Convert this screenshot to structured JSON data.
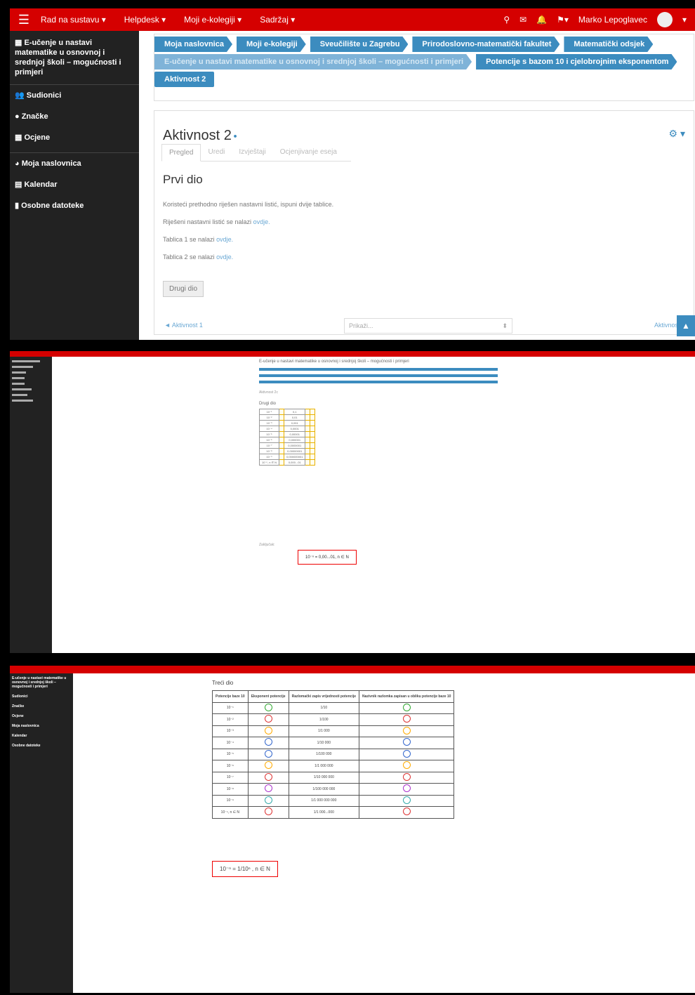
{
  "panel1": {
    "nav": {
      "menu": [
        "Rad na sustavu ▾",
        "Helpdesk ▾",
        "Moji e-kolegiji ▾",
        "Sadržaj ▾"
      ],
      "user": "Marko Lepoglavec"
    },
    "sidebar": {
      "course": "E-učenje u nastavi matematike u osnovnoj i srednjoj školi – mogućnosti i primjeri",
      "items": [
        "Sudionici",
        "Značke",
        "Ocjene"
      ],
      "items2": [
        "Moja naslovnica",
        "Kalendar",
        "Osobne datoteke"
      ]
    },
    "breadcrumbs": {
      "row1": [
        "Moja naslovnica",
        "Moji e-kolegiji",
        "Sveučilište u Zagrebu",
        "Prirodoslovno-matematički fakultet",
        "Matematički odsjek"
      ],
      "row2": [
        "E-učenje u nastavi matematike u osnovnoj i srednjoj školi – mogućnosti i primjeri",
        "Potencije s bazom 10 i cjelobrojnim eksponentom"
      ],
      "row3": [
        "Aktivnost 2"
      ]
    },
    "title": "Aktivnost 2",
    "tabs": [
      "Pregled",
      "Uredi",
      "Izvještaji",
      "Ocjenjivanje eseja"
    ],
    "section": "Prvi dio",
    "para1": "Koristeći prethodno riješen nastavni listić, ispuni dvije tablice.",
    "para2": "Riješeni nastavni listić se nalazi",
    "para3": "Tablica 1 se nalazi",
    "para4": "Tablica 2 se nalazi",
    "link": "ovdje.",
    "button": "Drugi dio",
    "prev": "◄ Aktivnost 1",
    "jump": "Prikaži...",
    "next": "Aktivnost 3"
  },
  "panel2": {
    "header": "E-učenje u nastavi matematike u osnovnoj i srednjoj školi – mogućnosti i primjeri",
    "title": "Aktivnost 2c",
    "section": "Drugi dio",
    "rows": [
      "10⁻¹",
      "10⁻²",
      "10⁻³",
      "10⁻⁴",
      "10⁻⁵",
      "10⁻⁶",
      "10⁻⁷",
      "10⁻⁸",
      "10⁻⁹",
      "10⁻ⁿ, n ∈ N"
    ],
    "values": [
      "0,1",
      "0,01",
      "0,001",
      "0,0001",
      "0,00001",
      "0,000001",
      "0,0000001",
      "0,00000001",
      "0,000000001",
      "0,000...01"
    ],
    "summary_label": "Zaključak:",
    "formula": "10⁻ⁿ = 0,00...01, n ∈ N"
  },
  "panel3": {
    "sidebar": [
      "E-učenje u nastavi matematike u osnovnoj i srednjoj školi – mogućnosti i primjeri",
      "Sudionici",
      "Značke",
      "Ocjene",
      "Moja naslovnica",
      "Kalendar",
      "Osobne datoteke"
    ],
    "title": "Treći dio",
    "headers": [
      "Potencije baze 10",
      "Eksponent potencije",
      "Razlomački zapis vrijednosti potencije",
      "Nazivnik razlomka zapisan u obliku potencije baze 10"
    ],
    "rows": [
      "10⁻¹",
      "10⁻²",
      "10⁻³",
      "10⁻⁴",
      "10⁻⁵",
      "10⁻⁶",
      "10⁻⁷",
      "10⁻⁸",
      "10⁻⁹",
      "10⁻ⁿ, n ∈ N"
    ],
    "fractions": [
      "1/10",
      "1/100",
      "1/1 000",
      "1/10 000",
      "1/100 000",
      "1/1 000 000",
      "1/10 000 000",
      "1/100 000 000",
      "1/1 000 000 000",
      "1/1 000...000"
    ],
    "formula": "10⁻ⁿ = 1/10ⁿ , n ∈ N"
  }
}
